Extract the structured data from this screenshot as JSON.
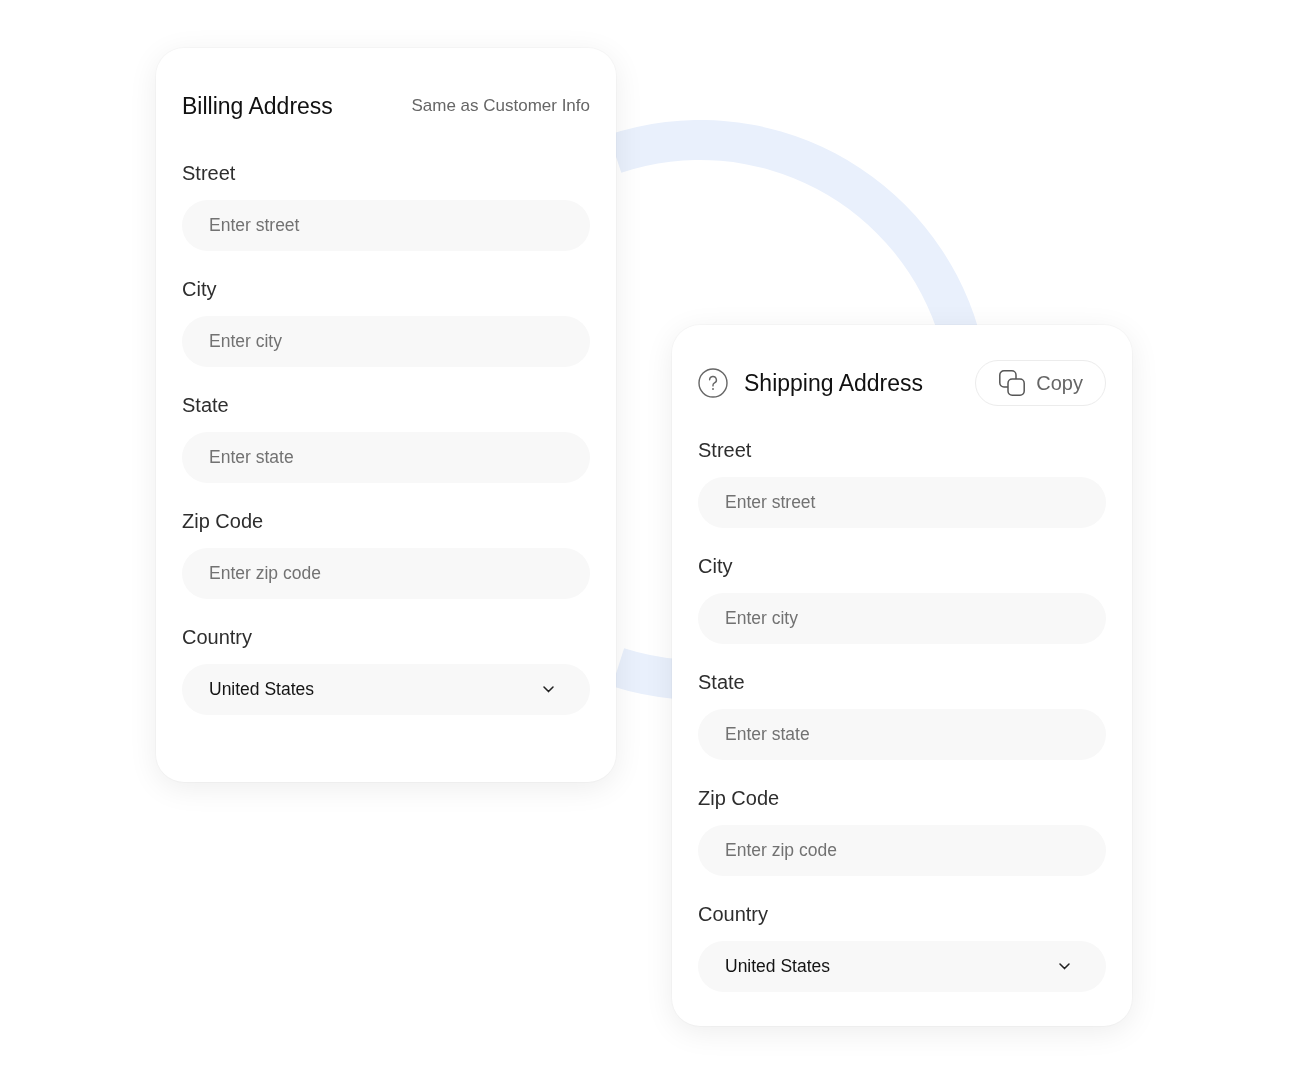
{
  "cards": [
    {
      "title": "Billing Address",
      "action": {
        "kind": "link",
        "label": "Same as Customer Info"
      },
      "fields": [
        {
          "kind": "text",
          "label": "Street",
          "placeholder": "Enter street"
        },
        {
          "kind": "text",
          "label": "City",
          "placeholder": "Enter city"
        },
        {
          "kind": "text",
          "label": "State",
          "placeholder": "Enter state"
        },
        {
          "kind": "text",
          "label": "Zip Code",
          "placeholder": "Enter zip code"
        },
        {
          "kind": "select",
          "label": "Country",
          "value": "United States"
        }
      ]
    },
    {
      "title": "Shipping Address",
      "help_icon": true,
      "action": {
        "kind": "copy",
        "label": "Copy"
      },
      "fields": [
        {
          "kind": "text",
          "label": "Street",
          "placeholder": "Enter street"
        },
        {
          "kind": "text",
          "label": "City",
          "placeholder": "Enter city"
        },
        {
          "kind": "text",
          "label": "State",
          "placeholder": "Enter state"
        },
        {
          "kind": "text",
          "label": "Zip Code",
          "placeholder": "Enter zip code"
        },
        {
          "kind": "select",
          "label": "Country",
          "value": "United States"
        }
      ]
    }
  ]
}
